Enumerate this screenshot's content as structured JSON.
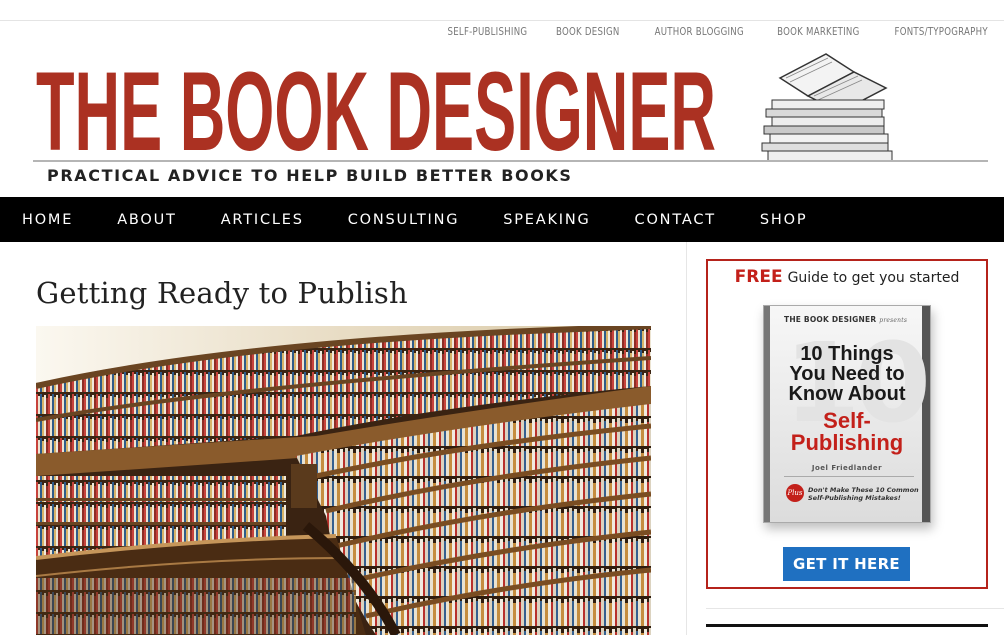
{
  "top_links": [
    {
      "label": "SELF-PUBLISHING"
    },
    {
      "label": "BOOK DESIGN"
    },
    {
      "label": "AUTHOR BLOGGING"
    },
    {
      "label": "BOOK MARKETING"
    },
    {
      "label": "FONTS/TYPOGRAPHY"
    }
  ],
  "masthead": {
    "site_title": "THE BOOK DESIGNER",
    "tagline": "PRACTICAL ADVICE TO HELP BUILD BETTER BOOKS",
    "title_color": "#ab3122"
  },
  "nav": {
    "items": [
      {
        "label": "HOME"
      },
      {
        "label": "ABOUT"
      },
      {
        "label": "ARTICLES"
      },
      {
        "label": "CONSULTING"
      },
      {
        "label": "SPEAKING"
      },
      {
        "label": "CONTACT"
      },
      {
        "label": "SHOP"
      }
    ]
  },
  "post": {
    "title": "Getting Ready to Publish"
  },
  "sidebar": {
    "promo": {
      "free_label": "FREE",
      "heading": "Guide to get you started",
      "ebook": {
        "brand": "THE BOOK DESIGNER",
        "brand_suffix": "presents",
        "big_number": "10",
        "title_line1": "10 Things",
        "title_line2": "You Need to",
        "title_line3": "Know About",
        "highlight_line1": "Self-",
        "highlight_line2": "Publishing",
        "author": "Joel Friedlander",
        "plus_label": "Plus",
        "subtitle": "Don't Make These 10 Common Self-Publishing Mistakes!"
      },
      "cta_label": "GET IT HERE",
      "accent_color": "#c3201a",
      "cta_color": "#1f70c1"
    }
  }
}
